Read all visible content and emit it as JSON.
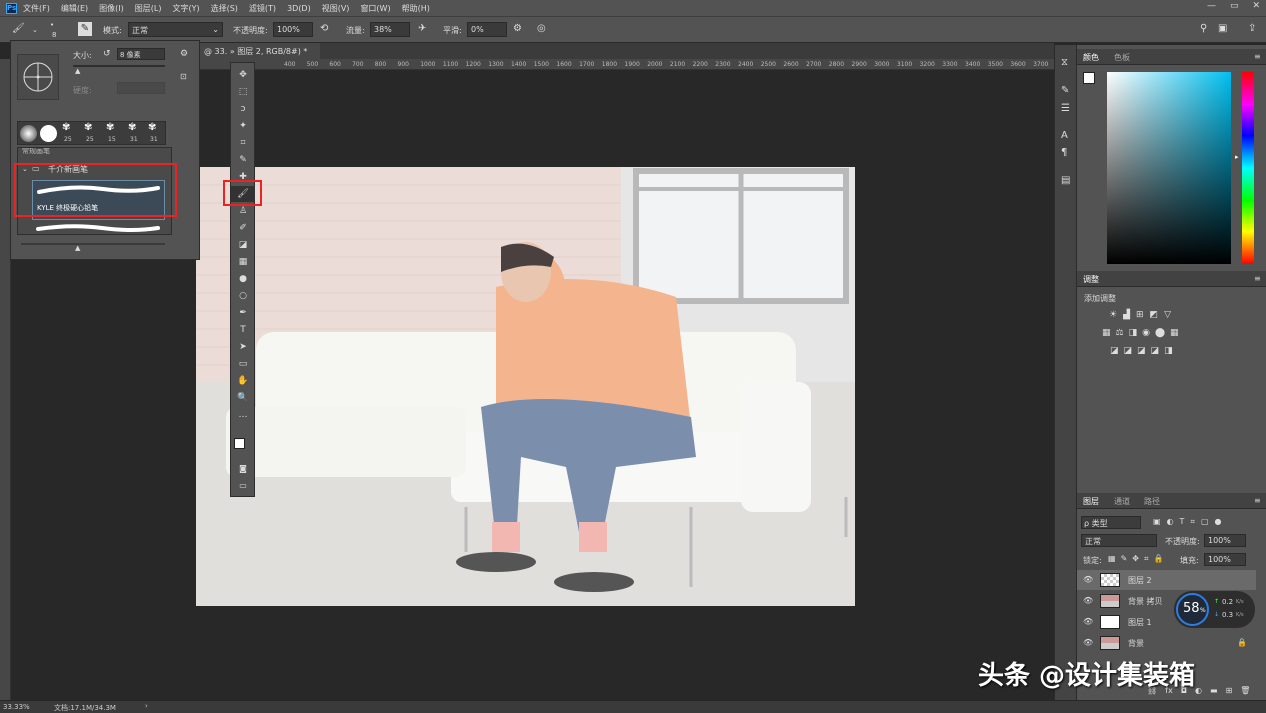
{
  "app": {
    "logo": "Ps"
  },
  "menu": [
    "文件(F)",
    "编辑(E)",
    "图像(I)",
    "图层(L)",
    "文字(Y)",
    "选择(S)",
    "滤镜(T)",
    "3D(D)",
    "视图(V)",
    "窗口(W)",
    "帮助(H)"
  ],
  "window_controls": {
    "minimize": "—",
    "restore": "▭",
    "close": "✕"
  },
  "options": {
    "brush_size_badge": "8",
    "mode_label": "模式:",
    "mode_value": "正常",
    "opacity_label": "不透明度:",
    "opacity_value": "100%",
    "flow_label": "流量:",
    "flow_value": "38%",
    "smooth_label": "平滑:",
    "smooth_value": "0%"
  },
  "doc": {
    "tab_title": "图层 2, RGB/8#) *",
    "tab_prefix": "@ 33.",
    "tab_close": "»"
  },
  "ruler_ticks": [
    "400",
    "500",
    "600",
    "700",
    "800",
    "900",
    "1000",
    "1100",
    "1200",
    "1300",
    "1400",
    "1500",
    "1600",
    "1700",
    "1800",
    "1900",
    "2000",
    "2100",
    "2200",
    "2300",
    "2400",
    "2500",
    "2600",
    "2700",
    "2800",
    "2900",
    "3000",
    "3100",
    "3200",
    "3300",
    "3400",
    "3500",
    "3600",
    "3700"
  ],
  "brush_panel": {
    "size_label": "大小:",
    "size_value": "8 像素",
    "hardness_label": "硬度:",
    "presets": [
      "",
      "",
      "25",
      "25",
      "15",
      "31",
      "31"
    ],
    "group_collapsed": "常规画笔",
    "group_open": "千介新画笔",
    "selected_brush": "KYLE 终极硬心铅笔"
  },
  "toolbar_icons": [
    "move-icon",
    "marquee-icon",
    "lasso-icon",
    "magic-wand-icon",
    "crop-icon",
    "eyedropper-icon",
    "healing-icon",
    "brush-icon",
    "stamp-icon",
    "history-brush-icon",
    "eraser-icon",
    "gradient-icon",
    "blur-icon",
    "dodge-icon",
    "pen-icon",
    "type-icon",
    "path-select-icon",
    "rectangle-icon",
    "hand-icon",
    "zoom-icon",
    "more-icon"
  ],
  "toolbar_glyphs": [
    "✥",
    "⬚",
    "ↄ",
    "✦",
    "⌗",
    "✎",
    "✚",
    "🖌",
    "♙",
    "✐",
    "◪",
    "▦",
    "●",
    "○",
    "✒",
    "T",
    "➤",
    "▭",
    "✋",
    "🔍",
    "…"
  ],
  "color_panel": {
    "tabs": [
      "颜色",
      "色板"
    ]
  },
  "adjust_panel": {
    "tab": "调整",
    "title": "添加调整",
    "row1": [
      "☀",
      "▟",
      "⊞",
      "◩",
      "▽"
    ],
    "row2": [
      "▦",
      "⚖",
      "◨",
      "◉",
      "⬤",
      "▦"
    ],
    "row3": [
      "◪",
      "◪",
      "◪",
      "◪",
      "◨"
    ]
  },
  "layers_panel": {
    "tabs": [
      "图层",
      "通道",
      "路径"
    ],
    "filter": "ρ 类型",
    "blend": "正常",
    "opacity_label": "不透明度:",
    "opacity_value": "100%",
    "lock_label": "锁定:",
    "fill_label": "填充:",
    "fill_value": "100%",
    "layers": [
      {
        "name": "图层 2",
        "thumb": "transparent",
        "selected": true
      },
      {
        "name": "背景 拷贝",
        "thumb": "photo",
        "selected": false
      },
      {
        "name": "图层 1",
        "thumb": "white",
        "selected": false
      },
      {
        "name": "背景",
        "thumb": "photo",
        "selected": false,
        "locked": true
      }
    ],
    "footer_icons": [
      "link-icon",
      "fx-icon",
      "mask-icon",
      "adjust-icon",
      "folder-icon",
      "new-layer-icon",
      "trash-icon"
    ],
    "footer_glyphs": [
      "⛓",
      "fx",
      "◘",
      "◐",
      "▬",
      "⊞",
      "🗑"
    ]
  },
  "net_widget": {
    "percent": "58",
    "unit": "%",
    "up": "0.2",
    "down": "0.3",
    "rate_unit": "K/s"
  },
  "status": {
    "zoom": "33.33%",
    "doc_info": "文档:17.1M/34.3M"
  },
  "watermark": "头条 @设计集装箱",
  "colors": {
    "accent_red": "#e22222",
    "panel": "#535353",
    "bg": "#282828"
  }
}
